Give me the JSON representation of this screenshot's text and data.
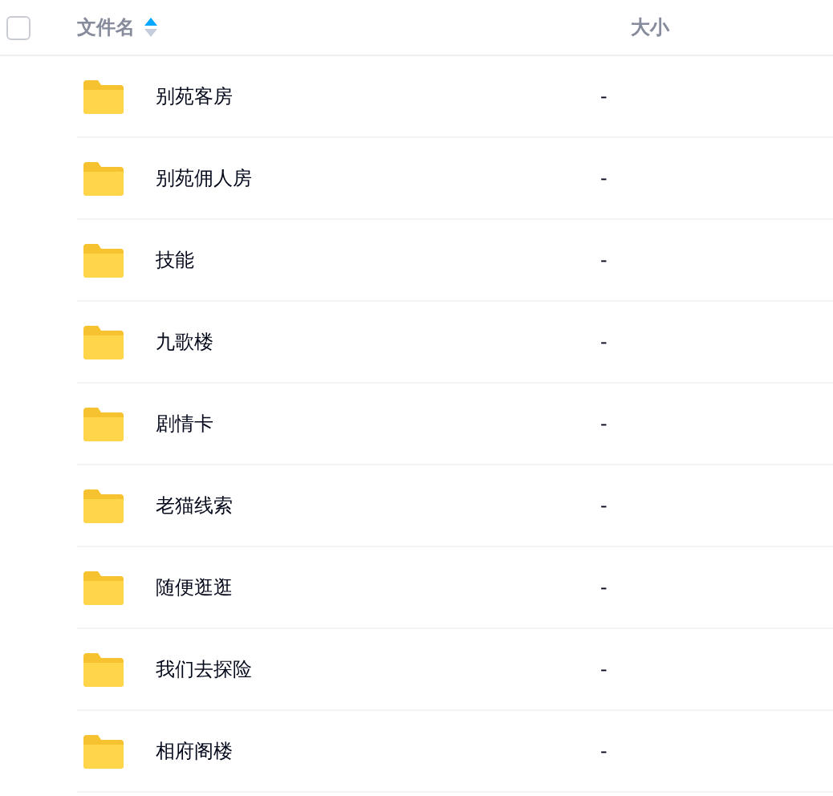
{
  "header": {
    "select_all": {
      "checked": false
    },
    "columns": [
      {
        "label": "文件名",
        "sorted": true
      },
      {
        "label": "大小",
        "sorted": false
      }
    ]
  },
  "rows": [
    {
      "name": "别苑客房",
      "size": "-"
    },
    {
      "name": "别苑佣人房",
      "size": "-"
    },
    {
      "name": "技能",
      "size": "-"
    },
    {
      "name": "九歌楼",
      "size": "-"
    },
    {
      "name": "剧情卡",
      "size": "-"
    },
    {
      "name": "老猫线索",
      "size": "-"
    },
    {
      "name": "随便逛逛",
      "size": "-"
    },
    {
      "name": "我们去探险",
      "size": "-"
    },
    {
      "name": "相府阁楼",
      "size": "-"
    }
  ]
}
